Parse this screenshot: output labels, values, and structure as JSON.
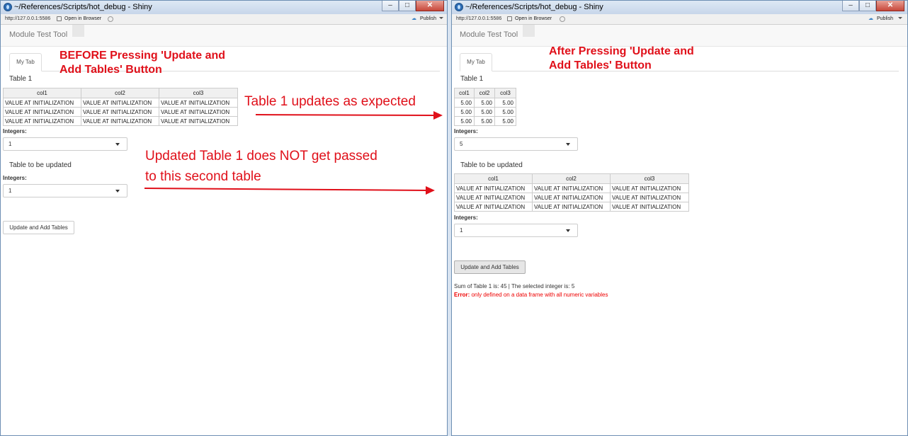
{
  "window_title": "~/References/Scripts/hot_debug - Shiny",
  "window_controls": {
    "minimize": "–",
    "maximize": "□",
    "close": "✕"
  },
  "toolbar": {
    "url": "http://127.0.0.1:5586",
    "open_in_browser": "Open in Browser",
    "publish": "Publish"
  },
  "app": {
    "brand": "Module Test Tool",
    "tab_label": "My Tab",
    "table1_title": "Table 1",
    "table2_title": "Table to be updated",
    "integers_label": "Integers:",
    "button_label": "Update and Add Tables"
  },
  "left_panel": {
    "table1": {
      "columns": [
        "col1",
        "col2",
        "col3"
      ],
      "rows": [
        [
          "VALUE AT INITIALIZATION",
          "VALUE AT INITIALIZATION",
          "VALUE AT INITIALIZATION"
        ],
        [
          "VALUE AT INITIALIZATION",
          "VALUE AT INITIALIZATION",
          "VALUE AT INITIALIZATION"
        ],
        [
          "VALUE AT INITIALIZATION",
          "VALUE AT INITIALIZATION",
          "VALUE AT INITIALIZATION"
        ]
      ]
    },
    "select1_value": "1",
    "select2_value": "1"
  },
  "right_panel": {
    "table1": {
      "columns": [
        "col1",
        "col2",
        "col3"
      ],
      "rows": [
        [
          "5.00",
          "5.00",
          "5.00"
        ],
        [
          "5.00",
          "5.00",
          "5.00"
        ],
        [
          "5.00",
          "5.00",
          "5.00"
        ]
      ]
    },
    "select1_value": "5",
    "table2": {
      "columns": [
        "col1",
        "col2",
        "col3"
      ],
      "rows": [
        [
          "VALUE AT INITIALIZATION",
          "VALUE AT INITIALIZATION",
          "VALUE AT INITIALIZATION"
        ],
        [
          "VALUE AT INITIALIZATION",
          "VALUE AT INITIALIZATION",
          "VALUE AT INITIALIZATION"
        ],
        [
          "VALUE AT INITIALIZATION",
          "VALUE AT INITIALIZATION",
          "VALUE AT INITIALIZATION"
        ]
      ]
    },
    "select2_value": "1",
    "output_text": "Sum of Table 1 is: 45 | The selected integer is: 5",
    "error_prefix": "Error:",
    "error_message": " only defined on a data frame with all numeric variables"
  },
  "annotations": {
    "before_line1": "BEFORE Pressing 'Update and",
    "before_line2": "Add Tables' Button",
    "after_line1": "After Pressing 'Update and",
    "after_line2": "Add Tables' Button",
    "table1_updates": "Table 1 updates as expected",
    "not_passed_line1": "Updated Table 1 does NOT get passed",
    "not_passed_line2": "to this second table"
  },
  "colors": {
    "annotation_red": "#e0101a",
    "error_red": "#ee0000",
    "title_blue": "#2d6db5"
  }
}
